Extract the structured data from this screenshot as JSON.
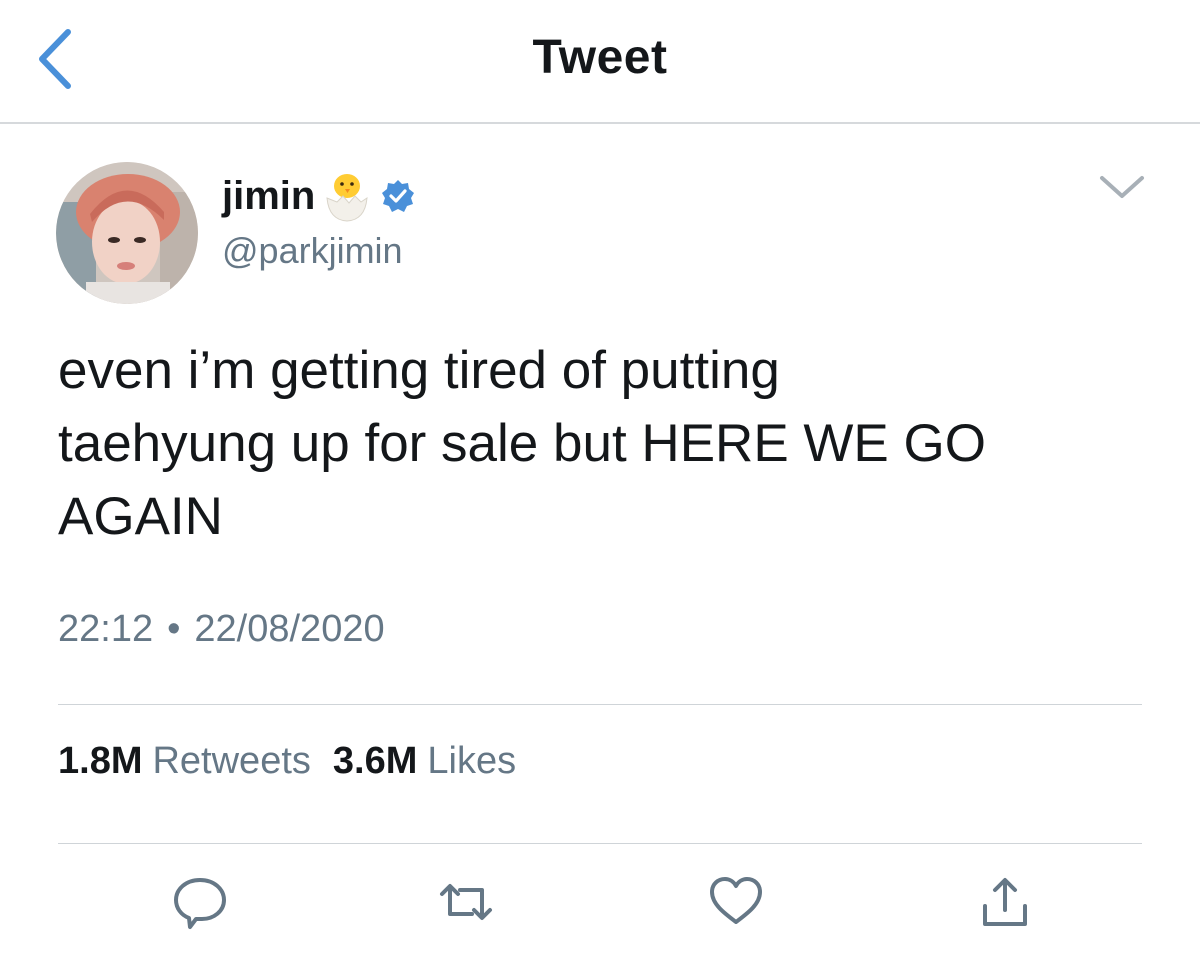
{
  "header": {
    "title": "Tweet",
    "back_icon": "chevron-left-icon",
    "accent": "#4a90d9"
  },
  "tweet": {
    "author_name": "jimin",
    "author_emoji": "hatching-chick-icon",
    "verified_icon": "verified-badge-icon",
    "handle": "@parkjimin",
    "text": "even i’m getting tired of putting\ntaehyung up for sale but HERE WE GO\nAGAIN",
    "time": "22:12",
    "separator": "•",
    "date": "22/08/2020",
    "options_icon": "chevron-down-icon"
  },
  "stats": {
    "retweets_count": "1.8M",
    "retweets_label": "Retweets",
    "likes_count": "3.6M",
    "likes_label": "Likes"
  },
  "actions": [
    {
      "name": "reply-icon"
    },
    {
      "name": "retweet-icon"
    },
    {
      "name": "like-icon"
    },
    {
      "name": "share-icon"
    }
  ],
  "colors": {
    "text": "#14171a",
    "secondary": "#657786",
    "verified": "#1da1f2",
    "divider": "#cfd4d8"
  }
}
